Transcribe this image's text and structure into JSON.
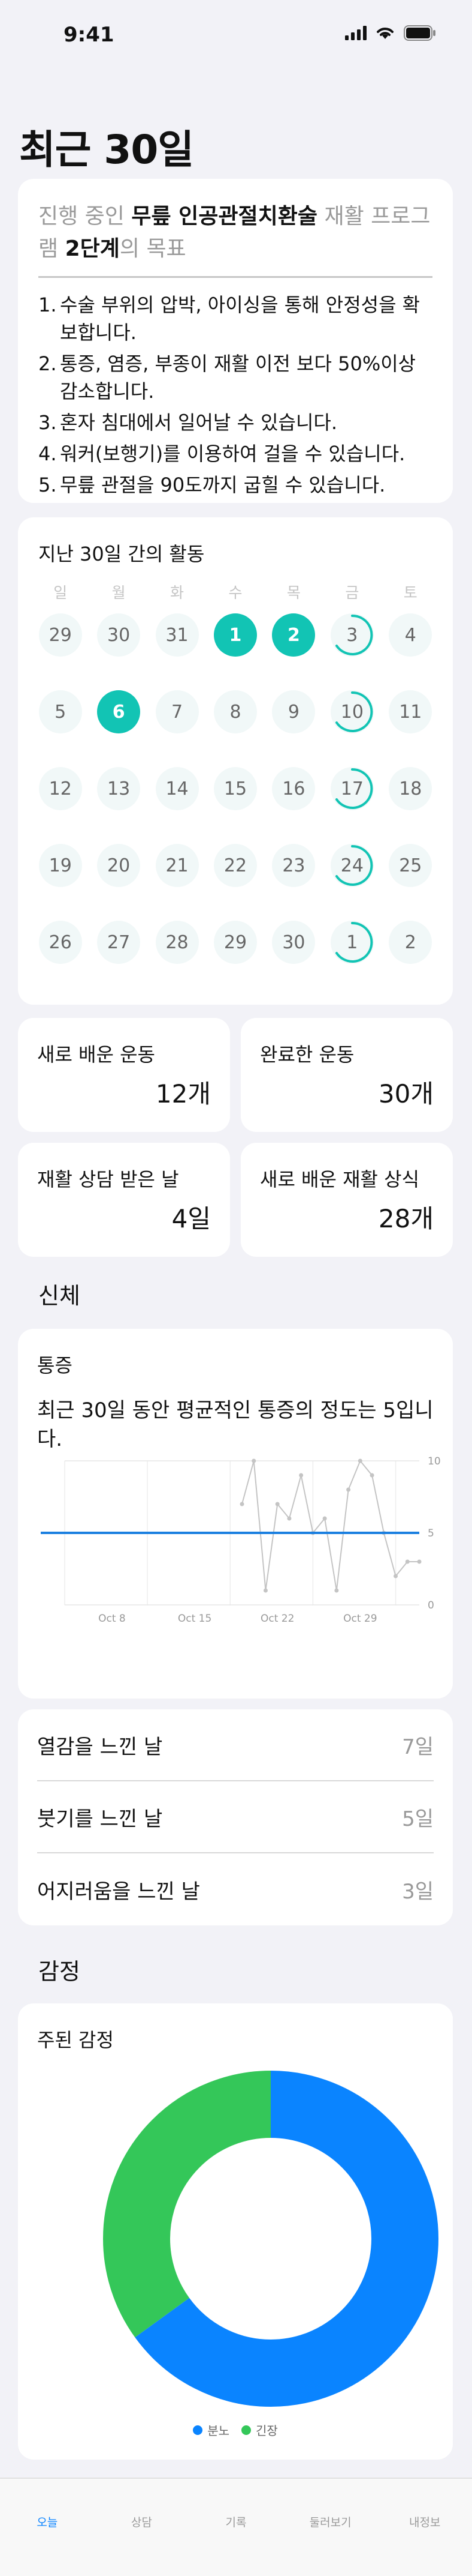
{
  "status_bar": {
    "time": "9:41"
  },
  "page": {
    "title": "최근 30일"
  },
  "goal": {
    "prefix": "진행 중인 ",
    "program": "무릎 인공관절치환술",
    "middle": " 재활 프로그램 ",
    "stage": "2단계",
    "suffix": "의 목표",
    "items": [
      {
        "num": "1.",
        "text": "수술 부위의 압박, 아이싱을 통해 안정성을 확보합니다."
      },
      {
        "num": "2.",
        "text": "통증, 염증, 부종이 재활 이전 보다 50%이상 감소합니다."
      },
      {
        "num": "3.",
        "text": "혼자 침대에서 일어날 수 있습니다."
      },
      {
        "num": "4.",
        "text": "워커(보행기)를 이용하여 걸을 수 있습니다."
      },
      {
        "num": "5.",
        "text": "무릎 관절을 90도까지 굽힐 수 있습니다."
      }
    ]
  },
  "activity": {
    "title": "지난 30일 간의 활동",
    "weekdays": [
      "일",
      "월",
      "화",
      "수",
      "목",
      "금",
      "토"
    ],
    "days": [
      {
        "d": "29",
        "s": "none"
      },
      {
        "d": "30",
        "s": "none"
      },
      {
        "d": "31",
        "s": "none"
      },
      {
        "d": "1",
        "s": "done"
      },
      {
        "d": "2",
        "s": "done"
      },
      {
        "d": "3",
        "s": "partial"
      },
      {
        "d": "4",
        "s": "none"
      },
      {
        "d": "5",
        "s": "none"
      },
      {
        "d": "6",
        "s": "done"
      },
      {
        "d": "7",
        "s": "none"
      },
      {
        "d": "8",
        "s": "none"
      },
      {
        "d": "9",
        "s": "none"
      },
      {
        "d": "10",
        "s": "partial"
      },
      {
        "d": "11",
        "s": "none"
      },
      {
        "d": "12",
        "s": "none"
      },
      {
        "d": "13",
        "s": "none"
      },
      {
        "d": "14",
        "s": "none"
      },
      {
        "d": "15",
        "s": "none"
      },
      {
        "d": "16",
        "s": "none"
      },
      {
        "d": "17",
        "s": "partial"
      },
      {
        "d": "18",
        "s": "none"
      },
      {
        "d": "19",
        "s": "none"
      },
      {
        "d": "20",
        "s": "none"
      },
      {
        "d": "21",
        "s": "none"
      },
      {
        "d": "22",
        "s": "none"
      },
      {
        "d": "23",
        "s": "none"
      },
      {
        "d": "24",
        "s": "partial"
      },
      {
        "d": "25",
        "s": "none"
      },
      {
        "d": "26",
        "s": "none"
      },
      {
        "d": "27",
        "s": "none"
      },
      {
        "d": "28",
        "s": "none"
      },
      {
        "d": "29",
        "s": "none"
      },
      {
        "d": "30",
        "s": "none"
      },
      {
        "d": "1",
        "s": "partial"
      },
      {
        "d": "2",
        "s": "none"
      }
    ]
  },
  "stats": {
    "new_exercises": {
      "label": "새로 배운 운동",
      "value": "12개"
    },
    "completed": {
      "label": "완료한 운동",
      "value": "30개"
    },
    "consult_days": {
      "label": "재활 상담 받은 날",
      "value": "4일"
    },
    "new_knowledge": {
      "label": "새로 배운 재활 상식",
      "value": "28개"
    }
  },
  "body": {
    "section_title": "신체",
    "pain_title": "통증",
    "pain_desc": "최근 30일 동안 평균적인 통증의 정도는 5입니다.",
    "symptoms": [
      {
        "label": "열감을 느낀 날",
        "value": "7일"
      },
      {
        "label": "붓기를 느낀 날",
        "value": "5일"
      },
      {
        "label": "어지러움을 느낀 날",
        "value": "3일"
      }
    ]
  },
  "emotion": {
    "section_title": "감정",
    "title": "주된 감정"
  },
  "tabs": [
    "오늘",
    "상담",
    "기록",
    "둘러보기",
    "내정보"
  ],
  "colors": {
    "accent": "#12c4b4",
    "blue": "#0a84ff",
    "green": "#34c759",
    "average_line": "#1a7fe0"
  },
  "chart_data": [
    {
      "type": "line",
      "x": [
        "Oct 4",
        "Oct 5",
        "Oct 6",
        "Oct 7",
        "Oct 8",
        "Oct 9",
        "Oct 10",
        "Oct 11",
        "Oct 12",
        "Oct 13",
        "Oct 14",
        "Oct 15",
        "Oct 16",
        "Oct 17",
        "Oct 18",
        "Oct 19",
        "Oct 20",
        "Oct 21",
        "Oct 22",
        "Oct 23",
        "Oct 24",
        "Oct 25",
        "Oct 26",
        "Oct 27",
        "Oct 28",
        "Oct 29",
        "Oct 30",
        "Oct 31",
        "Nov 1",
        "Nov 2",
        "Nov 3"
      ],
      "series": [
        {
          "values": [
            null,
            null,
            null,
            null,
            null,
            null,
            null,
            null,
            null,
            null,
            null,
            null,
            null,
            null,
            null,
            7,
            10,
            1,
            7,
            6,
            9,
            5,
            6,
            1,
            8,
            10,
            9,
            5,
            2,
            3,
            3
          ]
        }
      ],
      "average": 5,
      "x_tick_labels": [
        "Oct 8",
        "Oct 15",
        "Oct 22",
        "Oct 29"
      ],
      "y_tick_labels": [
        "0",
        "5",
        "10"
      ],
      "ylim": [
        0,
        10
      ],
      "grid": true
    },
    {
      "type": "pie",
      "categories": [
        "분노",
        "긴장"
      ],
      "values": [
        65,
        35
      ],
      "colors": [
        "#0a84ff",
        "#34c759"
      ],
      "legend": "bottom"
    }
  ]
}
